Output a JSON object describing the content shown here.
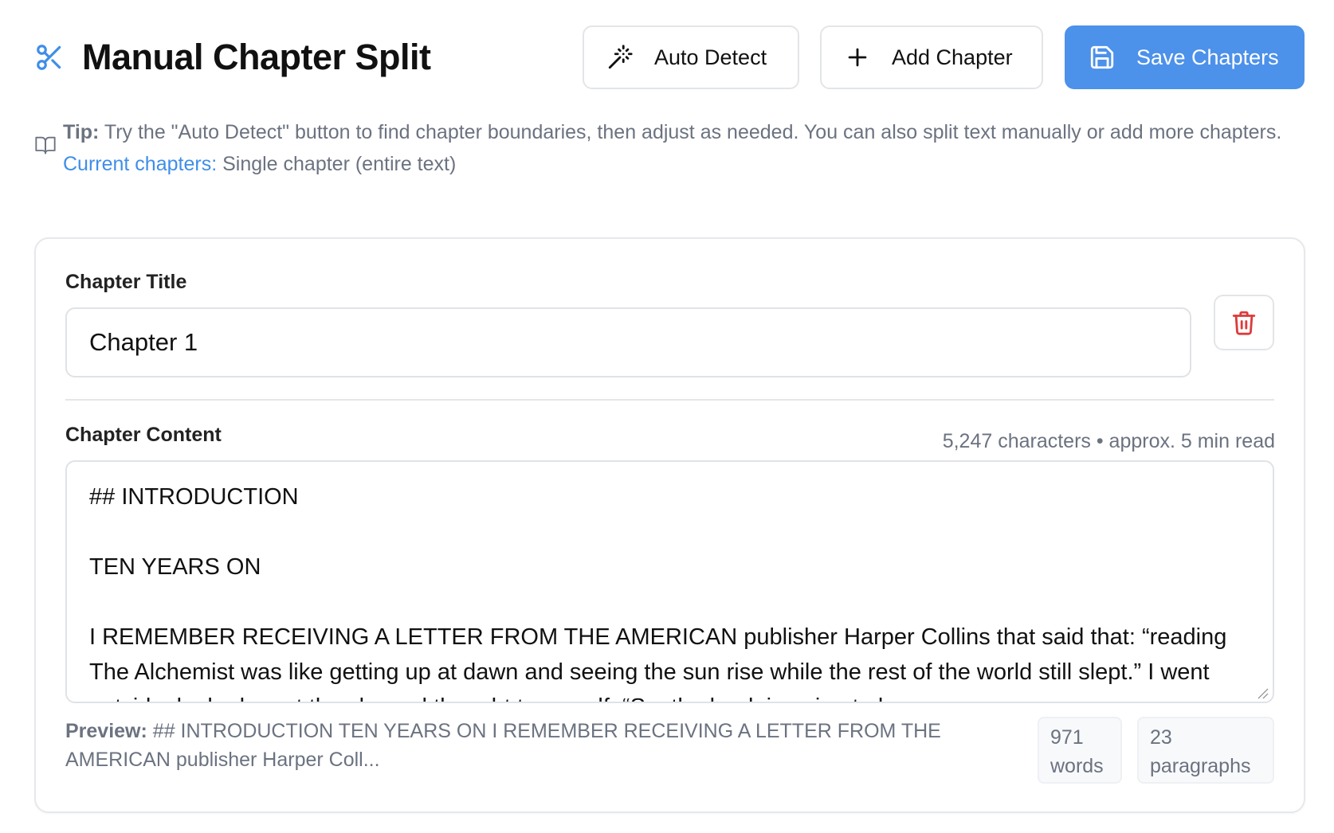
{
  "header": {
    "title": "Manual Chapter Split",
    "icon": "scissors-icon",
    "buttons": {
      "auto_detect": "Auto Detect",
      "add_chapter": "Add Chapter",
      "save_chapters": "Save Chapters"
    }
  },
  "tip": {
    "label": "Tip:",
    "text": " Try the \"Auto Detect\" button to find chapter boundaries, then adjust as needed. You can also split text manually or add more chapters.",
    "current_label": "Current chapters:",
    "current_value": " Single chapter (entire text)"
  },
  "chapter": {
    "title_label": "Chapter Title",
    "title_value": "Chapter 1",
    "content_label": "Chapter Content",
    "stats": "5,247 characters • approx. 5 min read",
    "content": "## INTRODUCTION\n\nTEN YEARS ON\n\nI REMEMBER RECEIVING A LETTER FROM THE AMERICAN publisher Harper Collins that said that: “reading The Alchemist was like getting up at dawn and seeing the sun rise while the rest of the world still slept.” I went outside, looked up at the sky and thought to myself: “So, the book is going to be",
    "preview_label": "Preview:",
    "preview_text": " ## INTRODUCTION TEN YEARS ON I REMEMBER RECEIVING A LETTER FROM THE AMERICAN publisher Harper Coll...",
    "words_count": "971",
    "words_label": "words",
    "paragraphs_count": "23",
    "paragraphs_label": "paragraphs"
  },
  "colors": {
    "primary": "#4c91ea",
    "danger": "#dc3b3b",
    "muted_text": "#6b7280",
    "link": "#3f8ee8"
  }
}
